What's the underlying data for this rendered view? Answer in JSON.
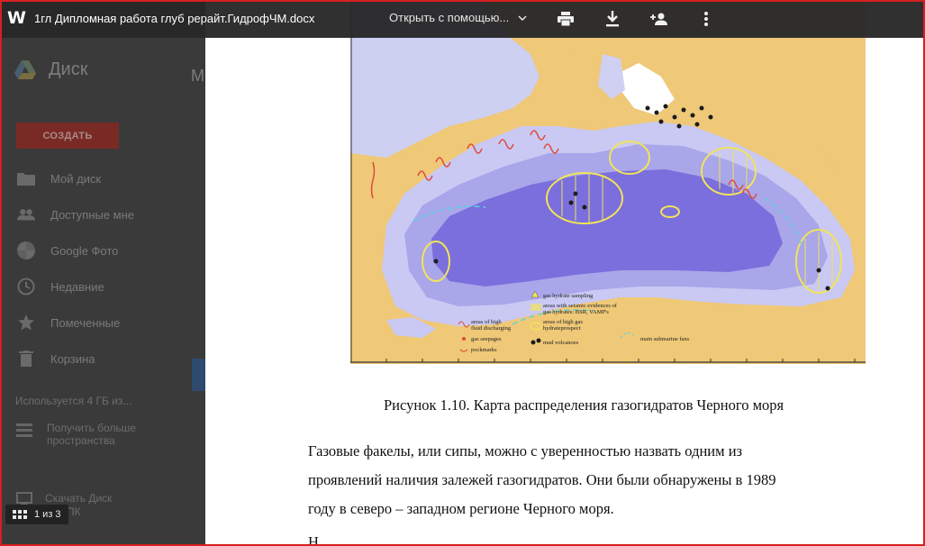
{
  "toolbar": {
    "app_icon": "word-icon",
    "app_letter": "W",
    "file_name": "1гл Дипломная работа глуб рерайт.ГидрофЧМ.docx",
    "open_with_label": "Открыть с помощью...",
    "icons": [
      "print-icon",
      "download-icon",
      "add-person-icon",
      "more-vert-icon"
    ]
  },
  "drive": {
    "title": "Диск",
    "m_letter": "М",
    "create_label": "СОЗДАТЬ",
    "nav": [
      {
        "icon": "folder-icon",
        "label": "Мой диск"
      },
      {
        "icon": "people-icon",
        "label": "Доступные мне"
      },
      {
        "icon": "photos-icon",
        "label": "Google Фото"
      },
      {
        "icon": "clock-icon",
        "label": "Недавние"
      },
      {
        "icon": "star-icon",
        "label": "Помеченные"
      },
      {
        "icon": "trash-icon",
        "label": "Корзина"
      }
    ],
    "storage_label": "Используется 4 ГБ из...",
    "more_space_line1": "Получить больше",
    "more_space_line2": "пространства",
    "download_line1": "Скачать Диск",
    "download_line2": "для ПК"
  },
  "page_indicator": "1 из 3",
  "document": {
    "legend": {
      "gas_hydrate_sampling": "gas hydrate sampling",
      "seismic_1": "areas with seismic evidences of",
      "seismic_2": "gas hydrates: BSR, VAMP's",
      "high_fluid_1": "areas of high",
      "high_fluid_2": "fluid discharging",
      "high_gas_1": "areas of high gas",
      "high_gas_2": "hydrateprospect",
      "submarine_fans": "main submarine fans",
      "gas_seepages": "gas seepages",
      "mud_volcanoes": "mud volcanoes",
      "pockmarks": "pockmarks"
    },
    "caption": "Рисунок 1.10. Карта распределения газогидратов Черного моря",
    "paragraph_lines": [
      "Газовые факелы, или сипы, можно с уверенностью назвать одним из",
      "проявлений наличия залежей газогидратов. Они были обнаружены в 1989",
      "году в северо – западном регионе Черного моря."
    ],
    "next_line_fragment": "Н"
  },
  "colors": {
    "land": "#efc878",
    "shelf": "#c9c9f3",
    "slope": "#a9a6ea",
    "deep": "#7a6fdc",
    "hydrate": "#f2e35a",
    "fluid": "#e04a3a"
  }
}
